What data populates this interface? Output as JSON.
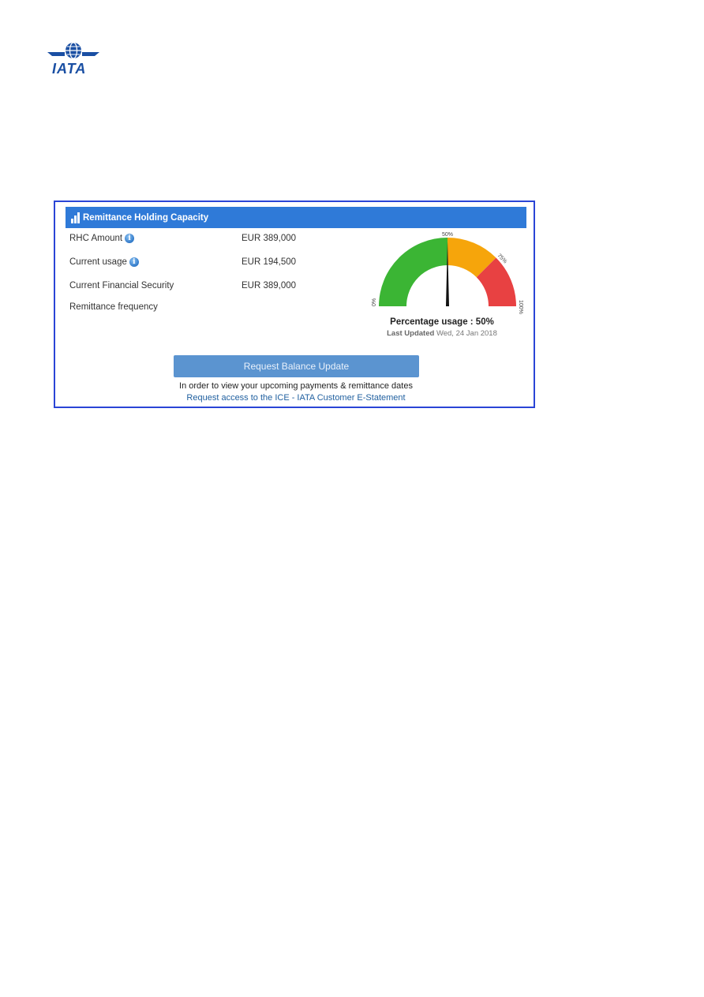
{
  "logo": {
    "text": "IATA",
    "icon": "iata-globe-wings-logo"
  },
  "panel": {
    "title": "Remittance Holding Capacity",
    "title_icon": "bar-chart-icon",
    "rows": [
      {
        "label": "RHC Amount",
        "value": "EUR 389,000",
        "info": true
      },
      {
        "label": "Current usage",
        "value": "EUR 194,500",
        "info": true
      },
      {
        "label": "Current Financial Security",
        "value": "EUR 389,000",
        "info": false
      },
      {
        "label": "Remittance frequency",
        "value": "",
        "info": false
      }
    ],
    "info_icon_glyph": "i"
  },
  "gauge": {
    "value_percent": 50,
    "tick_labels": {
      "min": "0%",
      "mid": "50%",
      "q3": "75%",
      "max": "100%"
    },
    "colors": {
      "green": "#3bb534",
      "orange": "#f6a50b",
      "red": "#e84142"
    },
    "caption": "Percentage usage : 50%",
    "updated_label": "Last Updated",
    "updated_date": "Wed, 24 Jan 2018"
  },
  "actions": {
    "request_button": "Request Balance Update",
    "note": "In order to view your upcoming payments & remittance dates",
    "link": "Request access to the ICE - IATA Customer E-Statement"
  }
}
